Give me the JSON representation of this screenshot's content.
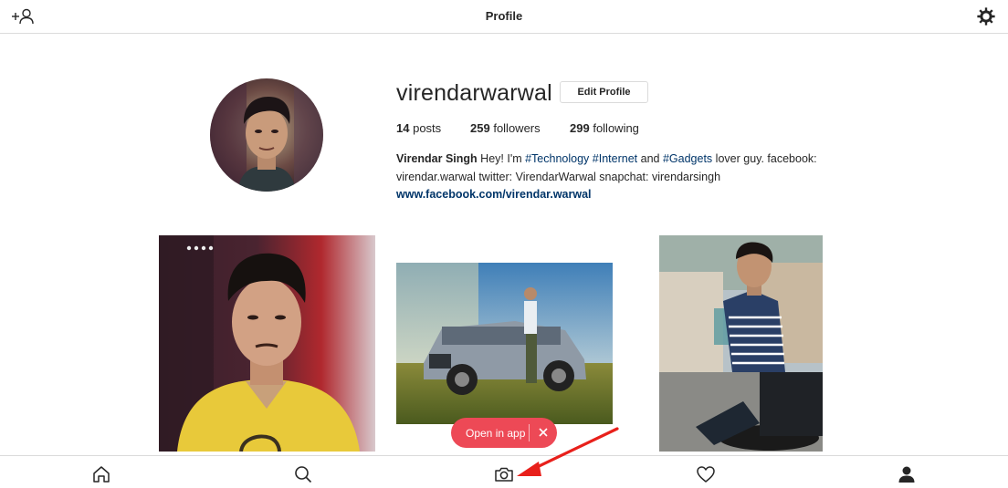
{
  "header": {
    "title": "Profile"
  },
  "profile": {
    "username": "virendarwarwal",
    "edit_label": "Edit Profile",
    "stats": {
      "posts_count": "14",
      "posts_label": "posts",
      "followers_count": "259",
      "followers_label": "followers",
      "following_count": "299",
      "following_label": "following"
    },
    "bio": {
      "full_name": "Virendar Singh",
      "text_1": "Hey! I'm",
      "tag_1": "#Technology",
      "tag_2": "#Internet",
      "text_2": "and",
      "tag_3": "#Gadgets",
      "text_3": "lover guy. facebook: virendar.warwal twitter: VirendarWarwal snapchat: virendarsingh",
      "website": "www.facebook.com/virendar.warwal"
    }
  },
  "banner": {
    "open_in_app_label": "Open in app"
  },
  "colors": {
    "accent": "#ed4956",
    "link": "#003569",
    "border": "#dbdbdb",
    "annotation_arrow": "#e8201b"
  },
  "icons": {
    "top_left": "add-user-icon",
    "top_right": "gear-icon",
    "nav": [
      "home-icon",
      "search-icon",
      "camera-icon",
      "heart-icon",
      "profile-icon"
    ],
    "banner_close": "close-icon"
  }
}
